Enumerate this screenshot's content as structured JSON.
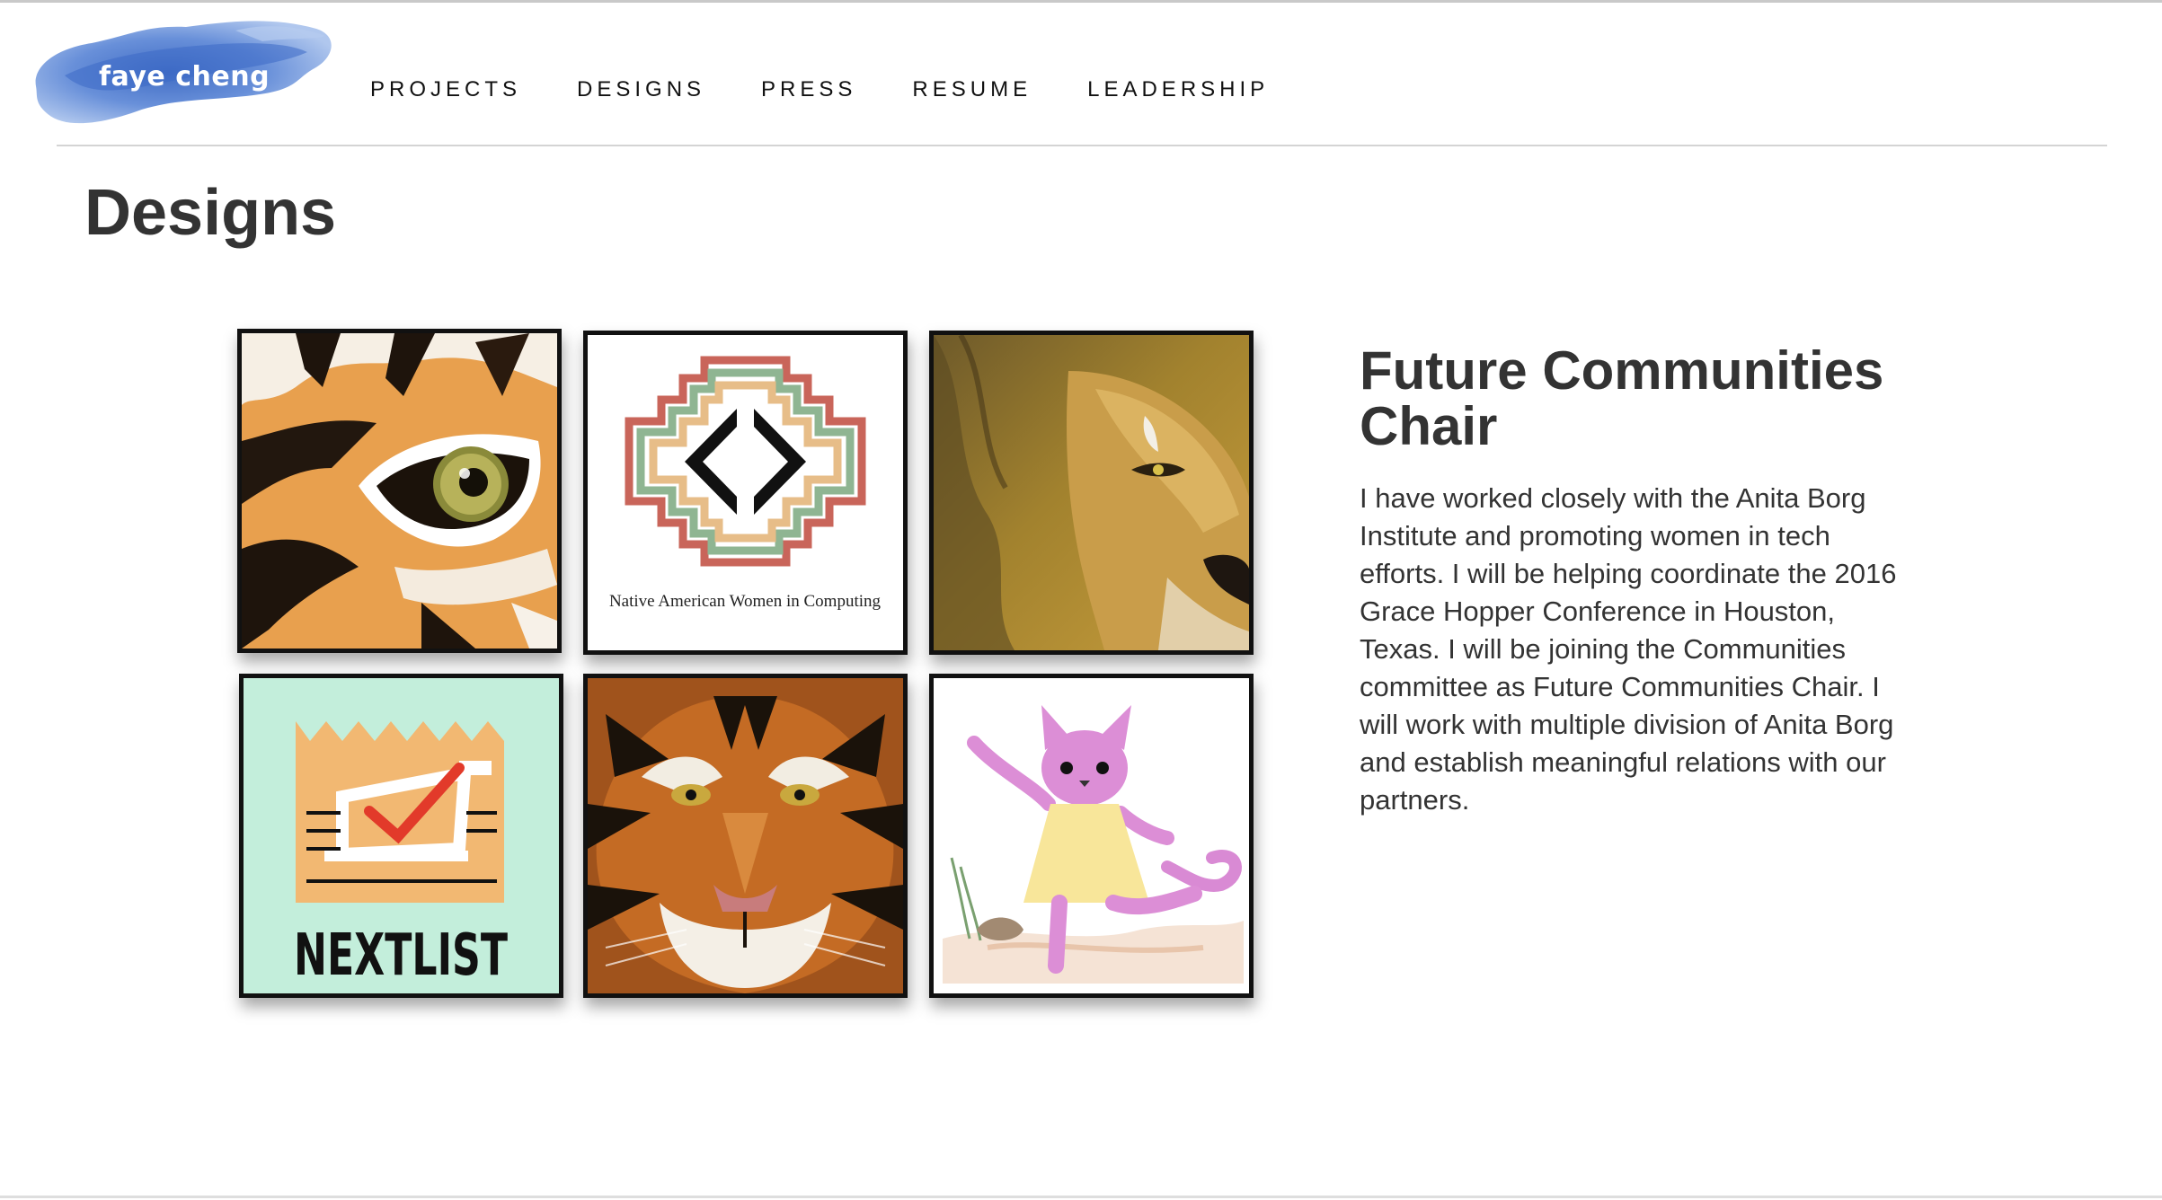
{
  "header": {
    "logo_text": "faye cheng",
    "nav": [
      "PROJECTS",
      "DESIGNS",
      "PRESS",
      "RESUME",
      "LEADERSHIP"
    ]
  },
  "page_title": "Designs",
  "gallery": {
    "tiles": [
      {
        "icon": "tiger-eye-artwork"
      },
      {
        "icon": "native-american-women-in-computing-logo",
        "caption": "Native American Women in Computing"
      },
      {
        "icon": "lion-drawing"
      },
      {
        "icon": "nextlist-logo",
        "caption": "NEXTLIST"
      },
      {
        "icon": "tiger-face-drawing"
      },
      {
        "icon": "pink-cat-illustration"
      }
    ]
  },
  "side": {
    "title": "Future Communities Chair",
    "body": "I have worked closely with the Anita Borg Institute and promoting women in tech efforts. I will be helping coordinate the 2016 Grace Hopper Conference in Houston, Texas. I will be joining the Communities committee as Future Communities Chair. I will work with multiple division of Anita Borg and establish meaningful relations with our partners."
  },
  "colors": {
    "text": "#333333",
    "nav_text": "#111111",
    "logo_blue": "#4a78c8",
    "tile_border": "#111111"
  }
}
